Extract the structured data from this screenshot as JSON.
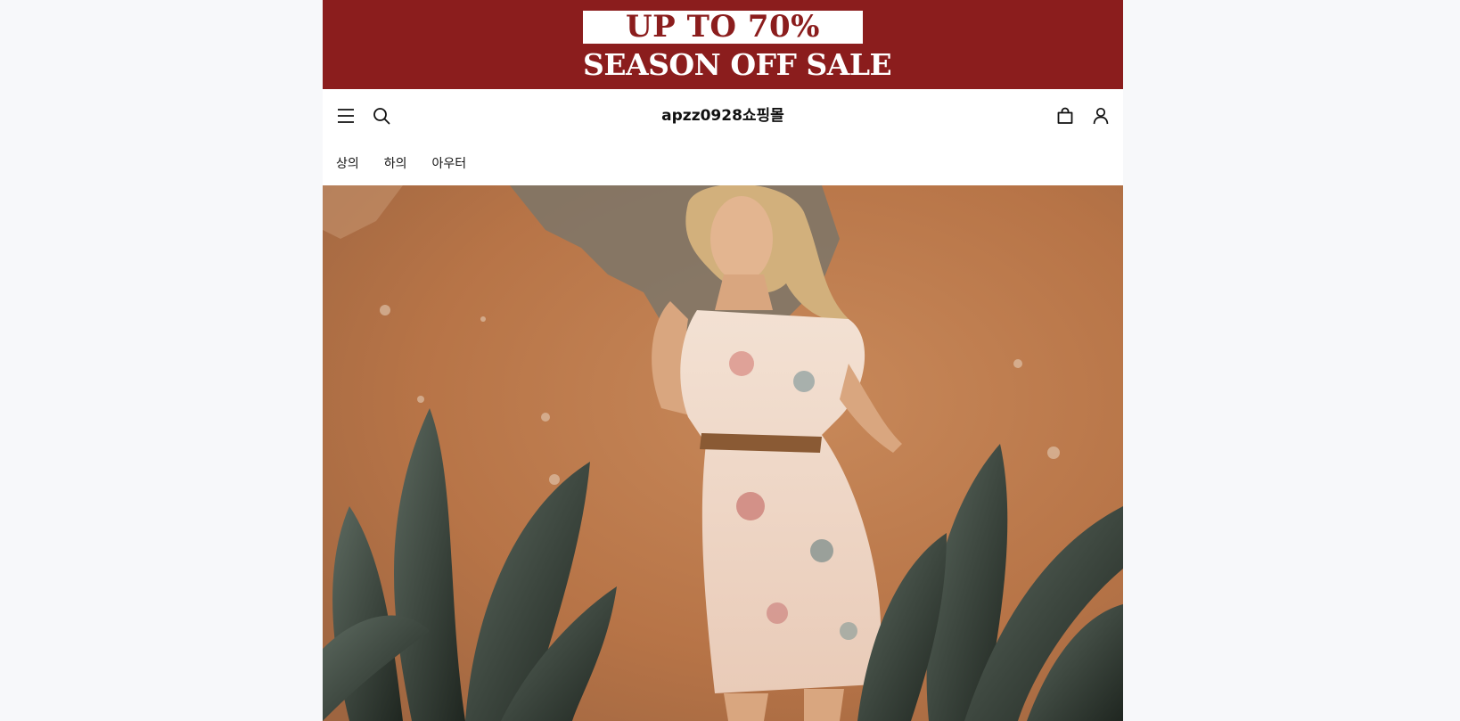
{
  "promo": {
    "line1": "UP TO 70%",
    "line2": "SEASON OFF SALE",
    "background": "#8b1d1d"
  },
  "header": {
    "logo": "apzz0928쇼핑몰",
    "icons": [
      "menu-icon",
      "search-icon",
      "shopping-bag-icon",
      "user-icon"
    ]
  },
  "nav": {
    "categories": [
      {
        "label": "상의"
      },
      {
        "label": "하의"
      },
      {
        "label": "아우터"
      }
    ]
  },
  "hero": {
    "subject": "main-banner-image"
  }
}
